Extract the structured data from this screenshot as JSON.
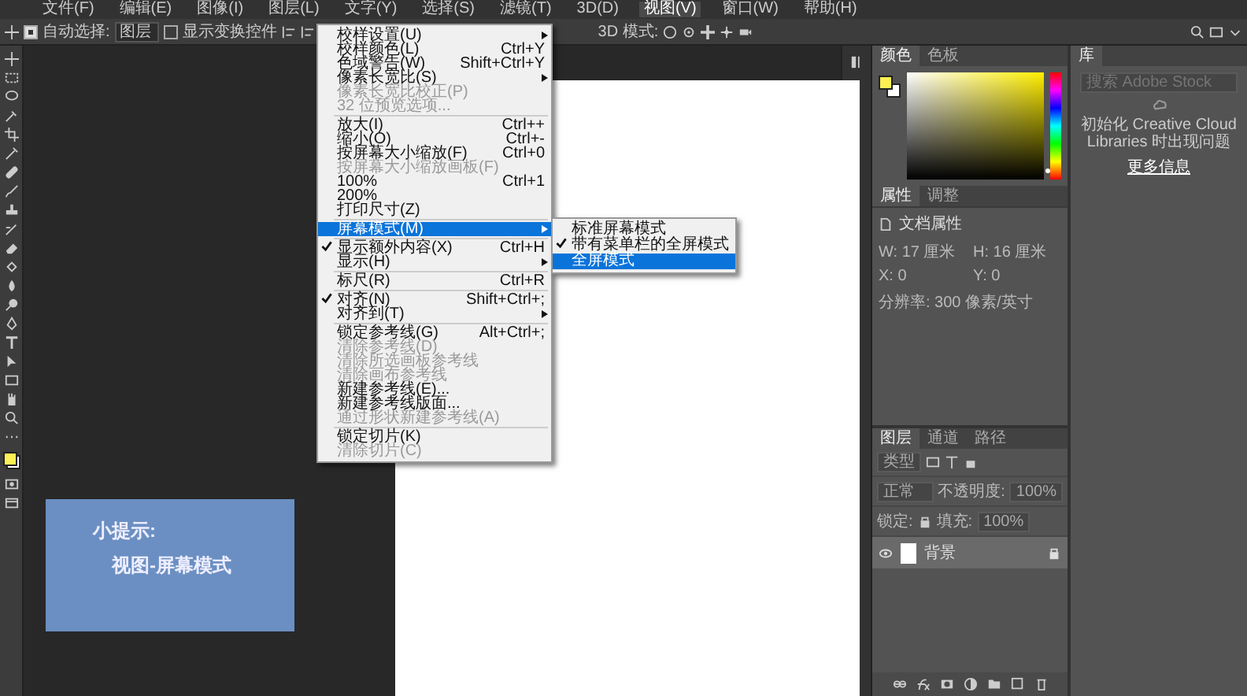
{
  "menu_bar": [
    {
      "label": "文件(F)",
      "selected": false
    },
    {
      "label": "编辑(E)",
      "selected": false
    },
    {
      "label": "图像(I)",
      "selected": false
    },
    {
      "label": "图层(L)",
      "selected": false
    },
    {
      "label": "文字(Y)",
      "selected": false
    },
    {
      "label": "选择(S)",
      "selected": false
    },
    {
      "label": "滤镜(T)",
      "selected": false
    },
    {
      "label": "3D(D)",
      "selected": false
    },
    {
      "label": "视图(V)",
      "selected": true
    },
    {
      "label": "窗口(W)",
      "selected": false
    },
    {
      "label": "帮助(H)",
      "selected": false
    }
  ],
  "options_bar": {
    "auto_select": {
      "label": "自动选择:",
      "checked": true
    },
    "target": "图层",
    "transform_controls": {
      "label": "显示变换控件",
      "checked": false
    },
    "mode_3d": "3D 模式:"
  },
  "view_menu": [
    {
      "kind": "item",
      "label": "校样设置(U)",
      "submenu": true,
      "disabled": false,
      "checked": false,
      "selected": false
    },
    {
      "kind": "item",
      "label": "校样颜色(L)",
      "shortcut": "Ctrl+Y",
      "submenu": false,
      "disabled": false,
      "checked": false,
      "selected": false
    },
    {
      "kind": "item",
      "label": "色域警告(W)",
      "shortcut": "Shift+Ctrl+Y",
      "submenu": false,
      "disabled": false,
      "checked": false,
      "selected": false
    },
    {
      "kind": "item",
      "label": "像素长宽比(S)",
      "submenu": true,
      "disabled": false,
      "checked": false,
      "selected": false
    },
    {
      "kind": "item",
      "label": "像素长宽比校正(P)",
      "submenu": false,
      "disabled": true,
      "checked": false,
      "selected": false
    },
    {
      "kind": "item",
      "label": "32 位预览选项...",
      "submenu": false,
      "disabled": true,
      "checked": false,
      "selected": false
    },
    {
      "kind": "separator"
    },
    {
      "kind": "item",
      "label": "放大(I)",
      "shortcut": "Ctrl++",
      "submenu": false,
      "disabled": false,
      "checked": false,
      "selected": false
    },
    {
      "kind": "item",
      "label": "缩小(O)",
      "shortcut": "Ctrl+-",
      "submenu": false,
      "disabled": false,
      "checked": false,
      "selected": false
    },
    {
      "kind": "item",
      "label": "按屏幕大小缩放(F)",
      "shortcut": "Ctrl+0",
      "submenu": false,
      "disabled": false,
      "checked": false,
      "selected": false
    },
    {
      "kind": "item",
      "label": "按屏幕大小缩放画板(F)",
      "submenu": false,
      "disabled": true,
      "checked": false,
      "selected": false
    },
    {
      "kind": "item",
      "label": "100%",
      "shortcut": "Ctrl+1",
      "submenu": false,
      "disabled": false,
      "checked": false,
      "selected": false
    },
    {
      "kind": "item",
      "label": "200%",
      "submenu": false,
      "disabled": false,
      "checked": false,
      "selected": false
    },
    {
      "kind": "item",
      "label": "打印尺寸(Z)",
      "submenu": false,
      "disabled": false,
      "checked": false,
      "selected": false
    },
    {
      "kind": "separator"
    },
    {
      "kind": "item",
      "label": "屏幕模式(M)",
      "submenu": true,
      "disabled": false,
      "checked": false,
      "selected": true
    },
    {
      "kind": "separator"
    },
    {
      "kind": "item",
      "label": "显示额外内容(X)",
      "shortcut": "Ctrl+H",
      "submenu": false,
      "disabled": false,
      "checked": true,
      "selected": false
    },
    {
      "kind": "item",
      "label": "显示(H)",
      "submenu": true,
      "disabled": false,
      "checked": false,
      "selected": false
    },
    {
      "kind": "separator"
    },
    {
      "kind": "item",
      "label": "标尺(R)",
      "shortcut": "Ctrl+R",
      "submenu": false,
      "disabled": false,
      "checked": false,
      "selected": false
    },
    {
      "kind": "separator"
    },
    {
      "kind": "item",
      "label": "对齐(N)",
      "shortcut": "Shift+Ctrl+;",
      "submenu": false,
      "disabled": false,
      "checked": true,
      "selected": false
    },
    {
      "kind": "item",
      "label": "对齐到(T)",
      "submenu": true,
      "disabled": false,
      "checked": false,
      "selected": false
    },
    {
      "kind": "separator"
    },
    {
      "kind": "item",
      "label": "锁定参考线(G)",
      "shortcut": "Alt+Ctrl+;",
      "submenu": false,
      "disabled": false,
      "checked": false,
      "selected": false
    },
    {
      "kind": "item",
      "label": "清除参考线(D)",
      "submenu": false,
      "disabled": true,
      "checked": false,
      "selected": false
    },
    {
      "kind": "item",
      "label": "清除所选画板参考线",
      "submenu": false,
      "disabled": true,
      "checked": false,
      "selected": false
    },
    {
      "kind": "item",
      "label": "清除画布参考线",
      "submenu": false,
      "disabled": true,
      "checked": false,
      "selected": false
    },
    {
      "kind": "item",
      "label": "新建参考线(E)...",
      "submenu": false,
      "disabled": false,
      "checked": false,
      "selected": false
    },
    {
      "kind": "item",
      "label": "新建参考线版面...",
      "submenu": false,
      "disabled": false,
      "checked": false,
      "selected": false
    },
    {
      "kind": "item",
      "label": "通过形状新建参考线(A)",
      "submenu": false,
      "disabled": true,
      "checked": false,
      "selected": false
    },
    {
      "kind": "separator"
    },
    {
      "kind": "item",
      "label": "锁定切片(K)",
      "submenu": false,
      "disabled": false,
      "checked": false,
      "selected": false
    },
    {
      "kind": "item",
      "label": "清除切片(C)",
      "submenu": false,
      "disabled": true,
      "checked": false,
      "selected": false
    }
  ],
  "screen_mode_submenu": [
    {
      "label": "标准屏幕模式",
      "checked": false,
      "selected": false
    },
    {
      "label": "带有菜单栏的全屏模式",
      "checked": true,
      "selected": false
    },
    {
      "label": "全屏模式",
      "checked": false,
      "selected": true
    }
  ],
  "color_panel": {
    "hue": {
      "level": 0.08
    },
    "tabs": [
      {
        "label": "颜色",
        "selected": true
      },
      {
        "label": "色板",
        "selected": false
      }
    ]
  },
  "properties_panel": {
    "tabs": [
      {
        "label": "属性",
        "selected": true
      },
      {
        "label": "调整",
        "selected": false
      }
    ],
    "title": "文档属性",
    "fields": [
      "W: 17 厘米",
      "H: 16 厘米",
      "X: 0",
      "Y: 0"
    ],
    "resolution": "分辨率: 300 像素/英寸"
  },
  "layers_panel": {
    "tabs": [
      {
        "label": "图层",
        "selected": true
      },
      {
        "label": "通道",
        "selected": false
      },
      {
        "label": "路径",
        "selected": false
      }
    ],
    "filter": "类型",
    "blend_mode": "正常",
    "opacity_label": "不透明度:",
    "opacity": "100%",
    "lock_label": "锁定:",
    "fill_label": "填充:",
    "fill": "100%",
    "layers": [
      {
        "name": "背景",
        "selected": true,
        "visible": true,
        "locked": true
      }
    ]
  },
  "libraries_panel": {
    "tabs": [
      {
        "label": "库",
        "selected": true
      }
    ],
    "search_placeholder": "搜索 Adobe Stock",
    "message": "初始化 Creative Cloud Libraries 时出现问题",
    "link": "更多信息"
  },
  "tip_card": {
    "title": "小提示:",
    "text": "视图-屏幕模式"
  }
}
